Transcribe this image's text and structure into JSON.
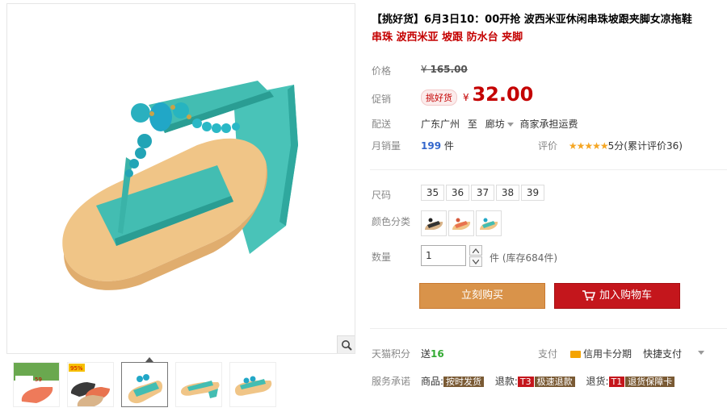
{
  "product": {
    "title": "【挑好货】6月3日10：00开抢 波西米亚休闲串珠坡跟夹脚女凉拖鞋",
    "subtitle": "串珠 波西米亚 坡跟 防水台 夹脚"
  },
  "price": {
    "label": "价格",
    "currency": "¥",
    "original": "165.00"
  },
  "promo": {
    "label": "促销",
    "badge": "挑好货",
    "currency": "¥",
    "price": "32.00"
  },
  "shipping": {
    "label": "配送",
    "from": "广东广州",
    "to_word": "至",
    "to": "廊坊",
    "note": "商家承担运费"
  },
  "sales": {
    "label": "月销量",
    "count": "199",
    "unit": "件"
  },
  "rating": {
    "label": "评价",
    "stars": "★★★★★",
    "text": "5分(累计评价36)"
  },
  "size": {
    "label": "尺码",
    "options": [
      "35",
      "36",
      "37",
      "38",
      "39"
    ]
  },
  "color": {
    "label": "颜色分类",
    "options": [
      "black-variant",
      "orange-variant",
      "turquoise-variant"
    ]
  },
  "quantity": {
    "label": "数量",
    "value": "1",
    "stock": "件 (库存684件)"
  },
  "buttons": {
    "buy_now": "立刻购买",
    "add_cart": "加入购物车"
  },
  "points": {
    "label": "天猫积分",
    "text": "送",
    "value": "16"
  },
  "payment": {
    "label": "支付",
    "credit": "信用卡分期",
    "quick": "快捷支付"
  },
  "promises": {
    "label": "服务承诺",
    "items": [
      {
        "prefix": "商品:",
        "tag": "按时发货"
      },
      {
        "prefix": "退款:",
        "badge": "T3",
        "tag": "极速退款"
      },
      {
        "prefix": "退货:",
        "badge": "T1",
        "tag": "退货保障卡"
      }
    ]
  },
  "thumbnails": [
    {
      "caption": "59",
      "badge": ""
    },
    {
      "caption": "",
      "badge": "95%"
    },
    {
      "caption": "",
      "badge": ""
    },
    {
      "caption": "",
      "badge": ""
    },
    {
      "caption": "",
      "badge": ""
    }
  ],
  "colors": {
    "price_red": "#c40000",
    "buy_orange": "#d9934a",
    "cart_red": "#c4161c",
    "shoe_turquoise": "#3cbfb4",
    "shoe_sole": "#f0c587"
  },
  "icons": [
    "zoom-icon",
    "cart-icon",
    "credit-card-icon",
    "chevron-down-icon",
    "up-arrow-icon",
    "down-arrow-icon"
  ]
}
